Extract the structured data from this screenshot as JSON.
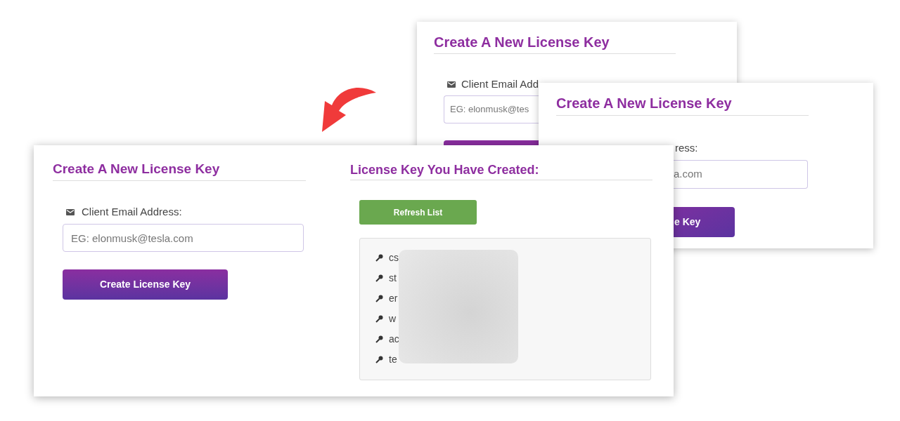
{
  "back_cards": [
    {
      "title": "Create A New License Key",
      "email_label": "Client Email Add",
      "email_placeholder": "EG: elonmusk@tes"
    },
    {
      "title": "Create A New License Key",
      "email_label": "ress:",
      "email_placeholder": "a.com",
      "button": "e Key"
    }
  ],
  "main_card": {
    "create_section": {
      "title": "Create A New License Key",
      "email_label": "Client Email Address:",
      "email_placeholder": "EG: elonmusk@tesla.com",
      "button": "Create License Key"
    },
    "keys_section": {
      "title": "License Key You Have Created:",
      "refresh_button": "Refresh List",
      "keys": [
        "cs",
        "st",
        "er",
        "w",
        "ac",
        "te"
      ]
    }
  }
}
